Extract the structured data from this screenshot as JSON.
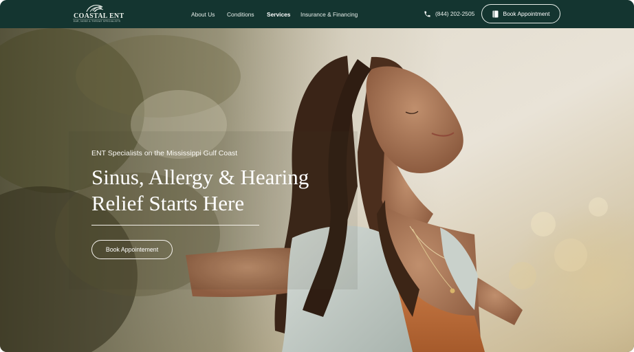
{
  "brand": {
    "name": "COASTAL ENT",
    "tagline": "EAR, NOSE & THROAT SPECIALISTS",
    "icon": "wave-logo"
  },
  "nav": {
    "items": [
      {
        "label": "About Us",
        "active": false
      },
      {
        "label": "Conditions",
        "active": false
      },
      {
        "label": "Services",
        "active": true
      },
      {
        "label": "Insurance & Financing",
        "active": false
      }
    ]
  },
  "header": {
    "phone": "(844) 202-2505",
    "phone_icon": "phone-icon",
    "book_label": "Book Appointment",
    "book_icon": "book-icon"
  },
  "hero": {
    "eyebrow": "ENT Specialists on the Mississippi Gulf Coast",
    "title_line1": "Sinus, Allergy & Hearing",
    "title_line2": "Relief Starts Here",
    "cta_label": "Book Appointement"
  },
  "colors": {
    "header_bg": "#143530",
    "accent_text": "#ffffff"
  }
}
